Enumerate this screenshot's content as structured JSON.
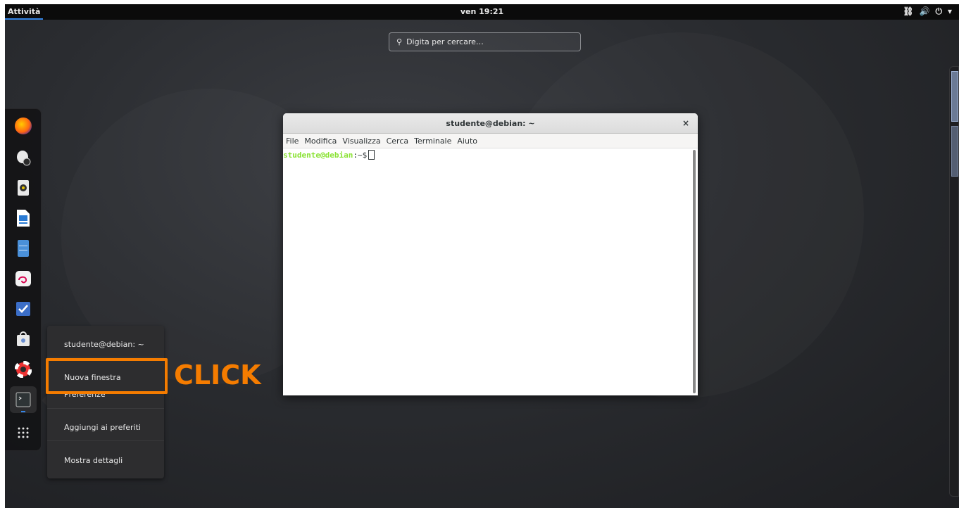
{
  "topbar": {
    "activities": "Attività",
    "clock": "ven 19:21"
  },
  "search": {
    "placeholder": "Digita per cercare…"
  },
  "dash": {
    "apps": [
      "firefox-icon",
      "hard-disk-icon",
      "rhythmbox-icon",
      "writer-icon",
      "files-icon",
      "debian-icon",
      "tasks-icon",
      "software-icon",
      "help-icon",
      "terminal-icon",
      "app-grid-icon"
    ]
  },
  "context_menu": {
    "title": "studente@debian: ~",
    "items": [
      "Nuova finestra",
      "Preferenze",
      "Aggiungi ai preferiti",
      "Mostra dettagli"
    ]
  },
  "annotation": {
    "label": "CLICK",
    "color": "#f57c00"
  },
  "terminal": {
    "title": "studente@debian: ~",
    "close": "×",
    "menu": [
      "File",
      "Modifica",
      "Visualizza",
      "Cerca",
      "Terminale",
      "Aiuto"
    ],
    "prompt_user": "studente@debian",
    "prompt_path": ":~$"
  },
  "colors": {
    "accent": "#3584e4",
    "prompt_green": "#8ae234"
  }
}
